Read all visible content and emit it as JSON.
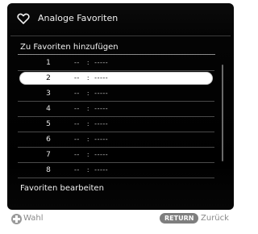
{
  "header": {
    "title": "Analoge Favoriten",
    "icon": "heart-icon"
  },
  "section": {
    "title": "Zu Favoriten hinzufügen"
  },
  "favorites": [
    {
      "number": "1",
      "channel": "--   :  -----"
    },
    {
      "number": "2",
      "channel": "--   :  -----",
      "selected": true
    },
    {
      "number": "3",
      "channel": "--   :  -----"
    },
    {
      "number": "4",
      "channel": "--   :  -----"
    },
    {
      "number": "5",
      "channel": "--   :  -----"
    },
    {
      "number": "6",
      "channel": "--   :  -----"
    },
    {
      "number": "7",
      "channel": "--   :  -----"
    },
    {
      "number": "8",
      "channel": "--   :  -----"
    }
  ],
  "edit": {
    "title": "Favoriten bearbeiten"
  },
  "footer": {
    "select_icon": "dpad-icon",
    "select_label": "Wahl",
    "return_badge": "RETURN",
    "return_label": "Zurück"
  },
  "colors": {
    "panel": "#000000",
    "selection": "#ffffff",
    "footer_text": "#8a8a8a"
  }
}
